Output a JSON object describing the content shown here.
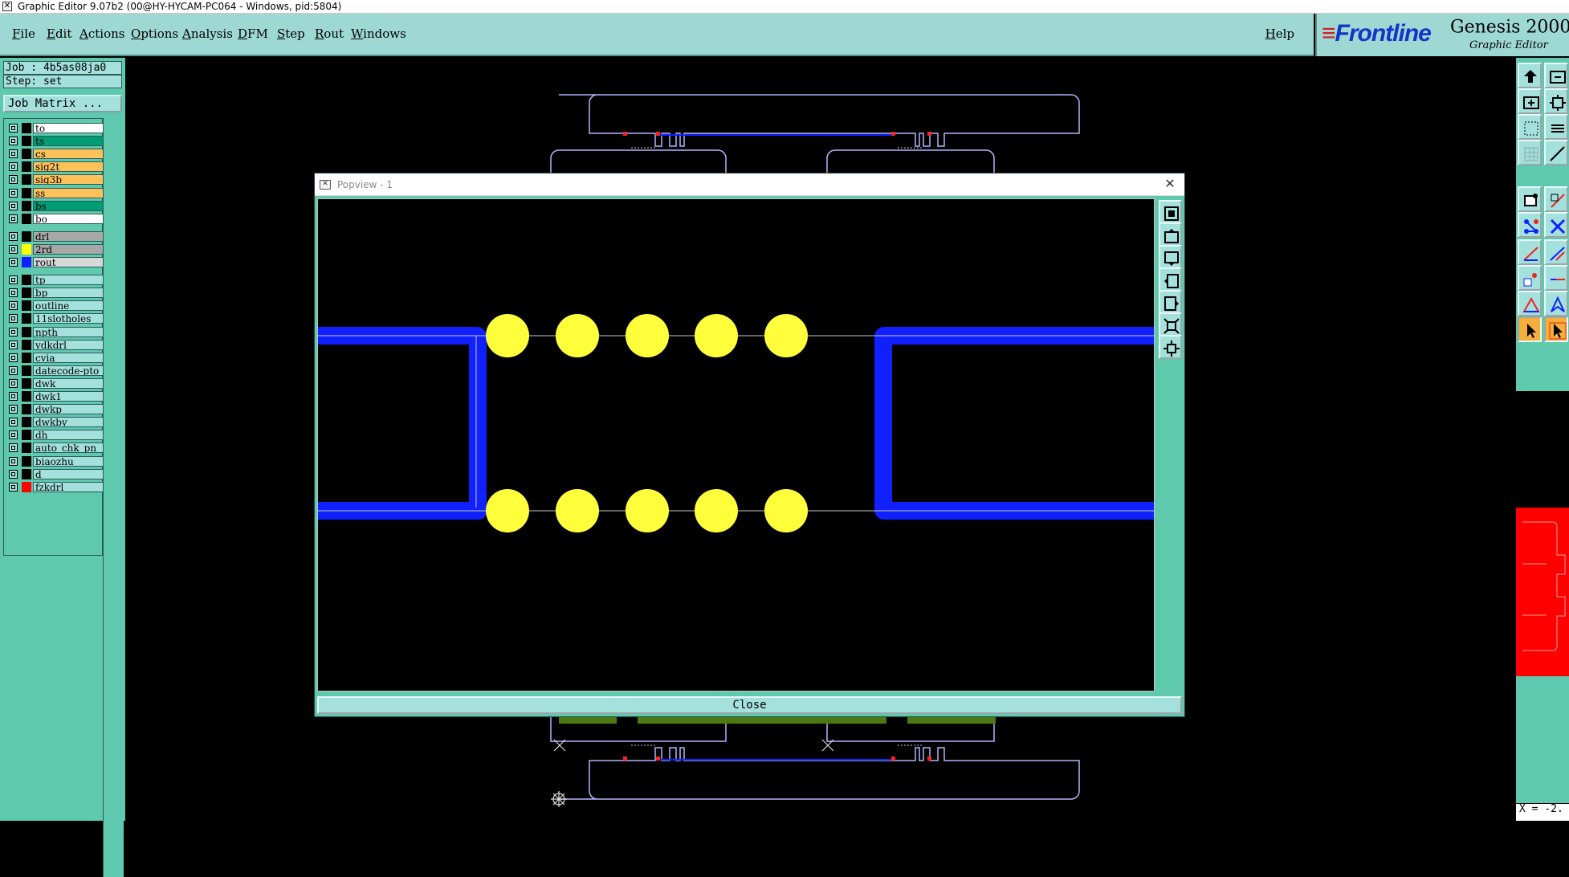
{
  "os_window": {
    "title": "Graphic Editor 9.07b2 (00@HY-HYCAM-PC064 - Windows, pid:5804)"
  },
  "menu": {
    "items": [
      "File",
      "Edit",
      "Actions",
      "Options",
      "Analysis",
      "DFM",
      "Step",
      "Rout",
      "Windows"
    ],
    "help": "Help"
  },
  "brand": {
    "frontline": "Frontline",
    "product": "Genesis 2000",
    "product_suffix": "®",
    "subtitle": "Graphic Editor"
  },
  "left": {
    "job": "Job : 4b5as08ja0",
    "step": "Step: set",
    "job_matrix_button": "Job Matrix ...",
    "layers": [
      {
        "name": "to",
        "swatch": "#000000",
        "bg": "#ffffff"
      },
      {
        "name": "ts",
        "swatch": "#000000",
        "bg": "#009c73"
      },
      {
        "name": "cs",
        "swatch": "#000000",
        "bg": "#ffc25a"
      },
      {
        "name": "sig2t",
        "swatch": "#000000",
        "bg": "#ffc25a"
      },
      {
        "name": "sig3b",
        "swatch": "#000000",
        "bg": "#ffc25a"
      },
      {
        "name": "ss",
        "swatch": "#000000",
        "bg": "#ffc25a"
      },
      {
        "name": "bs",
        "swatch": "#000000",
        "bg": "#009c73"
      },
      {
        "name": "bo",
        "swatch": "#000000",
        "bg": "#ffffff"
      },
      {
        "name": "drl",
        "swatch": "#000000",
        "bg": "#a8a8a8"
      },
      {
        "name": "2rd",
        "swatch": "#ffff00",
        "bg": "#a8a8a8"
      },
      {
        "name": "rout",
        "swatch": "#1020ff",
        "bg": "#d8d8d8"
      },
      {
        "name": "tp",
        "swatch": "#000000",
        "bg": "#a4e0dc"
      },
      {
        "name": "bp",
        "swatch": "#000000",
        "bg": "#a4e0dc"
      },
      {
        "name": "outline",
        "swatch": "#000000",
        "bg": "#a4e0dc"
      },
      {
        "name": "11slotholes",
        "swatch": "#000000",
        "bg": "#a4e0dc"
      },
      {
        "name": "npth",
        "swatch": "#000000",
        "bg": "#a4e0dc"
      },
      {
        "name": "ydkdrl",
        "swatch": "#000000",
        "bg": "#a4e0dc"
      },
      {
        "name": "cvia",
        "swatch": "#000000",
        "bg": "#a4e0dc"
      },
      {
        "name": "datecode-pto",
        "swatch": "#000000",
        "bg": "#a4e0dc"
      },
      {
        "name": "dwk",
        "swatch": "#000000",
        "bg": "#a4e0dc"
      },
      {
        "name": "dwk1",
        "swatch": "#000000",
        "bg": "#a4e0dc"
      },
      {
        "name": "dwkp",
        "swatch": "#000000",
        "bg": "#a4e0dc"
      },
      {
        "name": "dwkby",
        "swatch": "#000000",
        "bg": "#a4e0dc"
      },
      {
        "name": "dh",
        "swatch": "#000000",
        "bg": "#a4e0dc"
      },
      {
        "name": "auto_chk_pn",
        "swatch": "#000000",
        "bg": "#a4e0dc"
      },
      {
        "name": "biaozhu",
        "swatch": "#000000",
        "bg": "#a4e0dc"
      },
      {
        "name": "d",
        "swatch": "#000000",
        "bg": "#a4e0dc"
      },
      {
        "name": "fzkdrl",
        "swatch": "#ff0000",
        "bg": "#a4e0dc"
      }
    ]
  },
  "popview": {
    "title": "Popview - 1",
    "close_label": "Close"
  },
  "status": {
    "coord": "X = -2."
  },
  "colors": {
    "panel": "#5ec9ad",
    "panel_light": "#a4e0dc",
    "menubar": "#9ed8d3",
    "rout": "#1020ff",
    "pad": "#ffff3c",
    "outline": "#b4b4ff",
    "red_mark": "#ff2020",
    "minimap": "#ff0000"
  },
  "icons": {
    "right_toolbar": [
      "zoom-home-icon",
      "zoom-in-icon",
      "zoom-out-icon",
      "fit-icon",
      "zoom-window-icon",
      "pan-icon",
      "grid-icon",
      "measure-icon",
      "select-icon",
      "add-feature-icon",
      "connect-icon",
      "cut-icon",
      "line-icon",
      "angle-icon",
      "pad-icon",
      "slot-icon",
      "triangle-icon",
      "polygon-icon",
      "pointer-icon",
      "pointer-snap-icon"
    ],
    "popview_toolbar": [
      "zoom-home-icon",
      "zoom-in-icon",
      "zoom-out-icon",
      "pan-left-icon",
      "pan-right-icon",
      "fit-icon",
      "zoom-window-icon"
    ]
  }
}
